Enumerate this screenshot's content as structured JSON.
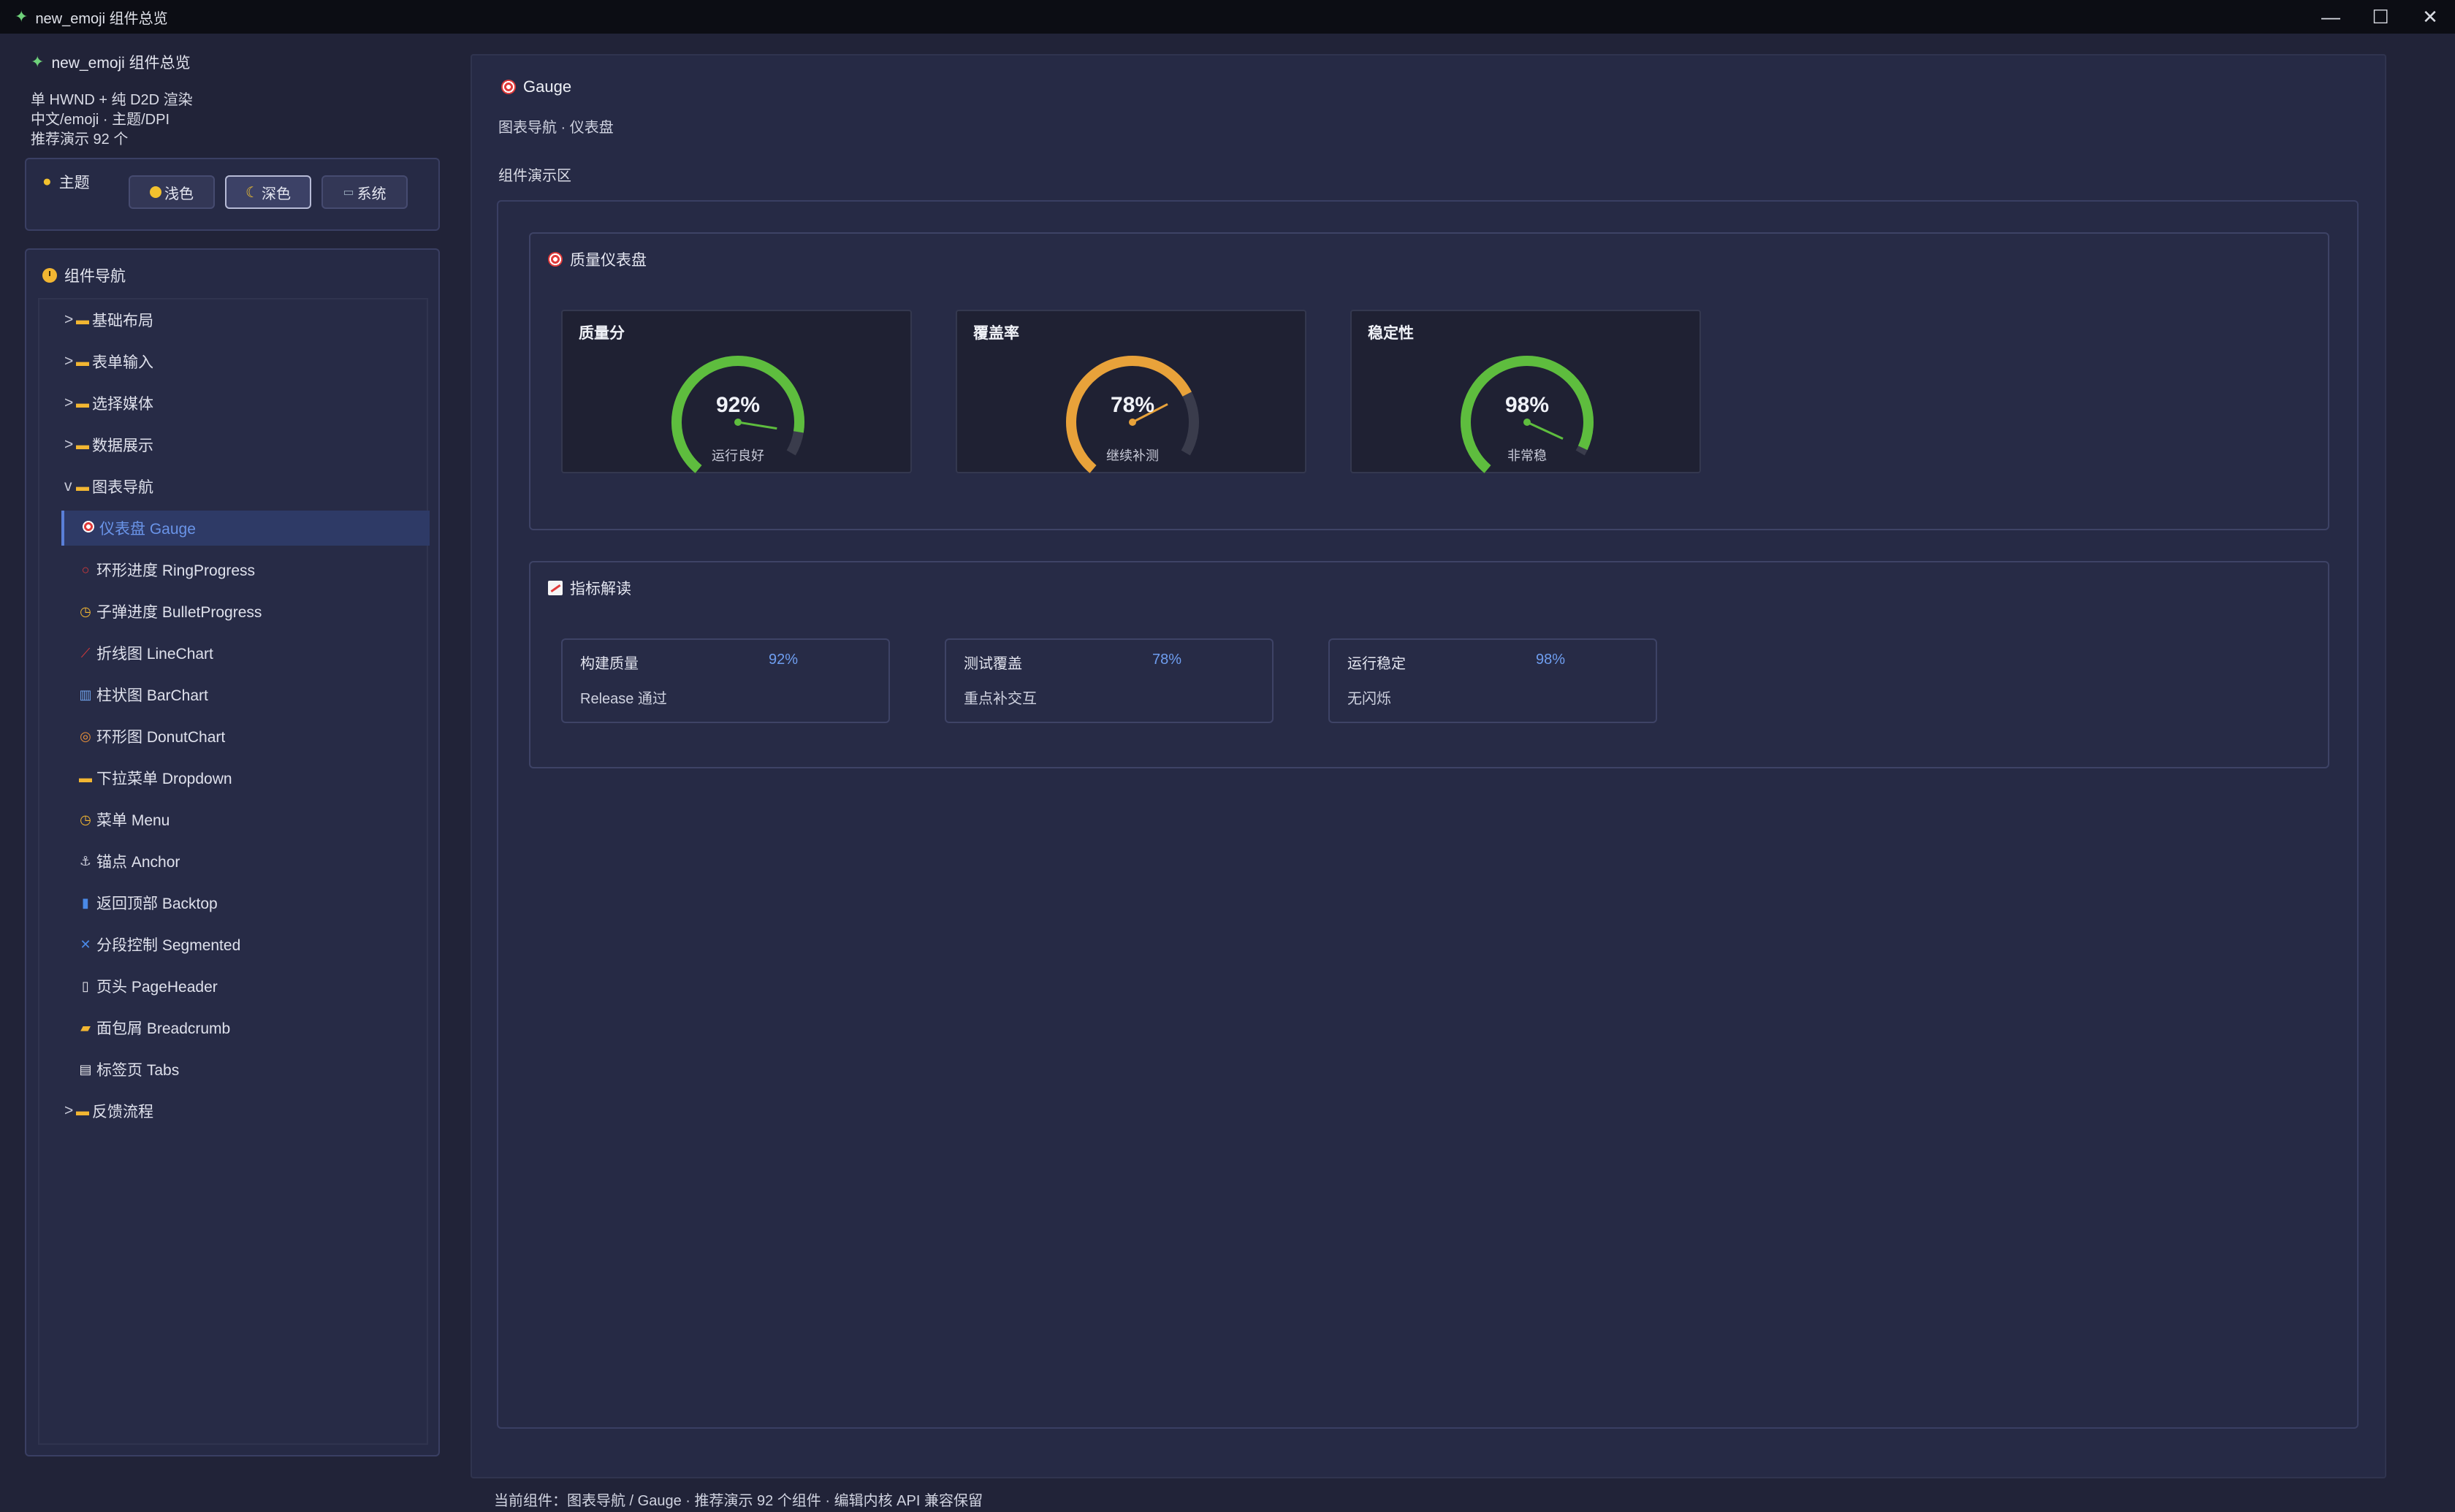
{
  "window": {
    "title": "new_emoji 组件总览",
    "app_icon": "sparkle-icon"
  },
  "sidebar": {
    "header": "new_emoji 组件总览",
    "desc_lines": [
      "单 HWND + 纯 D2D 渲染",
      "中文/emoji · 主题/DPI",
      "推荐演示 92 个"
    ],
    "theme": {
      "label": "主题",
      "buttons": [
        {
          "label": "浅色",
          "icon": "sun-icon",
          "active": false
        },
        {
          "label": "深色",
          "icon": "moon-icon",
          "active": true
        },
        {
          "label": "系统",
          "icon": "laptop-icon",
          "active": false
        }
      ]
    },
    "nav": {
      "title": "组件导航",
      "groups_before": [
        {
          "label": "基础布局",
          "expanded": false
        },
        {
          "label": "表单输入",
          "expanded": false
        },
        {
          "label": "选择媒体",
          "expanded": false
        },
        {
          "label": "数据展示",
          "expanded": false
        }
      ],
      "open_group": {
        "label": "图表导航",
        "expanded": true
      },
      "children": [
        {
          "label": "仪表盘 Gauge",
          "icon": "target-icon",
          "selected": true
        },
        {
          "label": "环形进度 RingProgress",
          "icon": "ring-icon"
        },
        {
          "label": "子弹进度 BulletProgress",
          "icon": "clock-icon"
        },
        {
          "label": "折线图 LineChart",
          "icon": "line-chart-icon"
        },
        {
          "label": "柱状图 BarChart",
          "icon": "bar-chart-icon"
        },
        {
          "label": "环形图 DonutChart",
          "icon": "donut-icon"
        },
        {
          "label": "下拉菜单 Dropdown",
          "icon": "folder-icon"
        },
        {
          "label": "菜单 Menu",
          "icon": "clock-icon"
        },
        {
          "label": "锚点 Anchor",
          "icon": "anchor-icon"
        },
        {
          "label": "返回顶部 Backtop",
          "icon": "info-icon"
        },
        {
          "label": "分段控制 Segmented",
          "icon": "shuffle-icon"
        },
        {
          "label": "页头 PageHeader",
          "icon": "page-icon"
        },
        {
          "label": "面包屑 Breadcrumb",
          "icon": "ticket-icon"
        },
        {
          "label": "标签页 Tabs",
          "icon": "tabs-icon"
        }
      ],
      "groups_after": [
        {
          "label": "反馈流程",
          "expanded": false
        }
      ]
    }
  },
  "main": {
    "title": "Gauge",
    "subtitle": "图表导航 · 仪表盘",
    "demo_label": "组件演示区",
    "gauge_card": {
      "title": "质量仪表盘",
      "gauges": [
        {
          "title": "质量分",
          "value": 92,
          "display": "92%",
          "caption": "运行良好",
          "color": "#5ebd3e"
        },
        {
          "title": "覆盖率",
          "value": 78,
          "display": "78%",
          "caption": "继续补测",
          "color": "#e8a23a"
        },
        {
          "title": "稳定性",
          "value": 98,
          "display": "98%",
          "caption": "非常稳",
          "color": "#5ebd3e"
        }
      ]
    },
    "metrics_card": {
      "title": "指标解读",
      "metrics": [
        {
          "name": "构建质量",
          "value": "92%",
          "desc": "Release 通过"
        },
        {
          "name": "测试覆盖",
          "value": "78%",
          "desc": "重点补交互"
        },
        {
          "name": "运行稳定",
          "value": "98%",
          "desc": "无闪烁"
        }
      ]
    }
  },
  "status": "当前组件：图表导航 / Gauge · 推荐演示 92 个组件 · 编辑内核 API 兼容保留",
  "colors": {
    "accent": "#6f9ef0",
    "gauge_track": "#3a3c4c",
    "selected_bg": "#2e3a66"
  }
}
